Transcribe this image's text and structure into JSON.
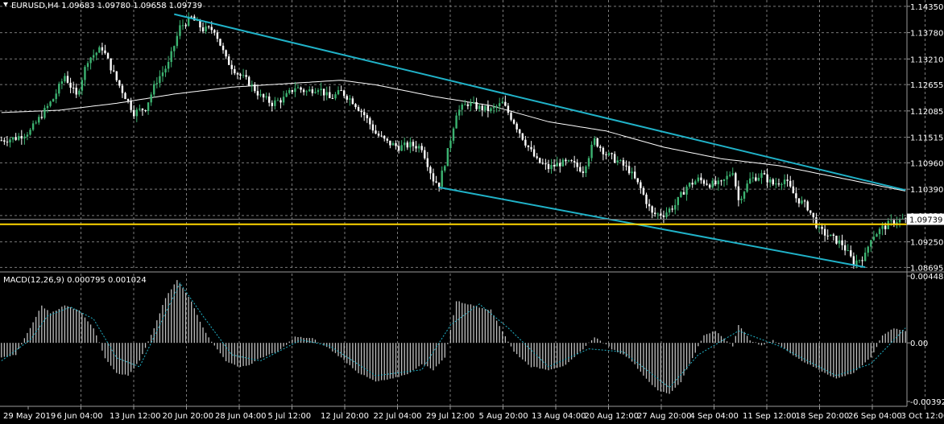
{
  "colors": {
    "background": "#000000",
    "grid": "#7a7a7a",
    "text": "#ffffff",
    "bull_candle": "#3cb371",
    "bear_candle": "#ffffff",
    "moving_average": "#ffffff",
    "channel": "#20b2c8",
    "horizontal_level": "#ffd700",
    "macd_histogram": "#c0c0c0",
    "macd_signal": "#20b2c8",
    "price_tag_bg": "#ffffff",
    "price_tag_text": "#000000"
  },
  "price_panel": {
    "title": "EURUSD,H4  1.09683 1.09780 1.09658 1.09739",
    "current_price_label": "1.09739",
    "y_ticks": [
      "1.14350",
      "1.13780",
      "1.13210",
      "1.12655",
      "1.12085",
      "1.11515",
      "1.10960",
      "1.10390",
      "1.09820",
      "1.09250",
      "1.08695"
    ]
  },
  "macd_panel": {
    "title": "MACD(12,26,9) 0.000795 0.001024",
    "y_ticks": [
      "0.004481",
      "0.00",
      "-0.003925"
    ]
  },
  "x_ticks": [
    "29 May 2019",
    "6 Jun 04:00",
    "13 Jun 12:00",
    "20 Jun 20:00",
    "28 Jun 04:00",
    "5 Jul 12:00",
    "12 Jul 20:00",
    "22 Jul 04:00",
    "29 Jul 12:00",
    "5 Aug 20:00",
    "13 Aug 04:00",
    "20 Aug 12:00",
    "27 Aug 20:00",
    "4 Sep 04:00",
    "11 Sep 12:00",
    "18 Sep 20:00",
    "26 Sep 04:00",
    "3 Oct 12:00"
  ],
  "chart_data": [
    {
      "type": "candlestick",
      "symbol": "EURUSD",
      "timeframe": "H4",
      "ohlc_last": {
        "open": 1.09683,
        "high": 1.0978,
        "low": 1.09658,
        "close": 1.09739
      },
      "ylim": [
        1.0865,
        1.144
      ],
      "close_path": [
        [
          0,
          1.1145
        ],
        [
          5,
          1.115
        ],
        [
          10,
          1.1165
        ],
        [
          18,
          1.1235
        ],
        [
          22,
          1.1285
        ],
        [
          26,
          1.124
        ],
        [
          30,
          1.132
        ],
        [
          35,
          1.1345
        ],
        [
          40,
          1.1275
        ],
        [
          46,
          1.1205
        ],
        [
          50,
          1.1215
        ],
        [
          54,
          1.1275
        ],
        [
          58,
          1.131
        ],
        [
          62,
          1.139
        ],
        [
          66,
          1.141
        ],
        [
          70,
          1.1385
        ],
        [
          74,
          1.1385
        ],
        [
          78,
          1.132
        ],
        [
          82,
          1.129
        ],
        [
          86,
          1.127
        ],
        [
          90,
          1.124
        ],
        [
          94,
          1.1225
        ],
        [
          98,
          1.1235
        ],
        [
          102,
          1.126
        ],
        [
          106,
          1.125
        ],
        [
          110,
          1.126
        ],
        [
          114,
          1.1235
        ],
        [
          118,
          1.125
        ],
        [
          122,
          1.123
        ],
        [
          126,
          1.12
        ],
        [
          130,
          1.116
        ],
        [
          134,
          1.114
        ],
        [
          138,
          1.113
        ],
        [
          142,
          1.1135
        ],
        [
          146,
          1.113
        ],
        [
          150,
          1.106
        ],
        [
          152,
          1.105
        ],
        [
          155,
          1.112
        ],
        [
          158,
          1.1205
        ],
        [
          162,
          1.1225
        ],
        [
          166,
          1.1215
        ],
        [
          170,
          1.121
        ],
        [
          174,
          1.1225
        ],
        [
          178,
          1.1185
        ],
        [
          182,
          1.114
        ],
        [
          186,
          1.11
        ],
        [
          190,
          1.1085
        ],
        [
          194,
          1.1095
        ],
        [
          198,
          1.1095
        ],
        [
          202,
          1.108
        ],
        [
          206,
          1.1145
        ],
        [
          210,
          1.1115
        ],
        [
          214,
          1.11
        ],
        [
          218,
          1.108
        ],
        [
          222,
          1.104
        ],
        [
          226,
          1.0985
        ],
        [
          230,
          1.0985
        ],
        [
          234,
          1.1005
        ],
        [
          238,
          1.1045
        ],
        [
          242,
          1.106
        ],
        [
          246,
          1.105
        ],
        [
          250,
          1.105
        ],
        [
          254,
          1.108
        ],
        [
          256,
          1.1015
        ],
        [
          260,
          1.106
        ],
        [
          264,
          1.107
        ],
        [
          268,
          1.105
        ],
        [
          272,
          1.106
        ],
        [
          276,
          1.102
        ],
        [
          280,
          1.1
        ],
        [
          284,
          1.095
        ],
        [
          288,
          1.0935
        ],
        [
          292,
          1.092
        ],
        [
          296,
          1.088
        ],
        [
          300,
          1.0895
        ],
        [
          302,
          1.0935
        ],
        [
          306,
          1.0955
        ],
        [
          310,
          1.097
        ],
        [
          314,
          1.0974
        ]
      ],
      "moving_average": [
        [
          0,
          1.1205
        ],
        [
          20,
          1.121
        ],
        [
          40,
          1.1225
        ],
        [
          60,
          1.1245
        ],
        [
          80,
          1.126
        ],
        [
          100,
          1.1268
        ],
        [
          118,
          1.1275
        ],
        [
          130,
          1.1265
        ],
        [
          150,
          1.124
        ],
        [
          170,
          1.122
        ],
        [
          190,
          1.1185
        ],
        [
          210,
          1.1165
        ],
        [
          230,
          1.113
        ],
        [
          250,
          1.1105
        ],
        [
          270,
          1.109
        ],
        [
          290,
          1.1065
        ],
        [
          314,
          1.1035
        ]
      ],
      "channel_upper": [
        [
          60,
          1.1418
        ],
        [
          314,
          1.1037
        ]
      ],
      "channel_lower": [
        [
          152,
          1.1043
        ],
        [
          300,
          1.087
        ]
      ],
      "horizontal_level": 1.0963
    },
    {
      "type": "bar",
      "name": "MACD(12,26,9)",
      "ylim": [
        -0.003925,
        0.004481
      ],
      "histogram_path": [
        [
          0,
          -0.001
        ],
        [
          5,
          -0.0008
        ],
        [
          10,
          0.001
        ],
        [
          14,
          0.0025
        ],
        [
          17,
          0.002
        ],
        [
          22,
          0.0025
        ],
        [
          27,
          0.0022
        ],
        [
          32,
          0.001
        ],
        [
          36,
          -0.001
        ],
        [
          40,
          -0.002
        ],
        [
          44,
          -0.0022
        ],
        [
          48,
          -0.0012
        ],
        [
          52,
          0.0005
        ],
        [
          57,
          0.003
        ],
        [
          61,
          0.0042
        ],
        [
          66,
          0.0028
        ],
        [
          70,
          0.001
        ],
        [
          74,
          -0.0002
        ],
        [
          78,
          -0.0012
        ],
        [
          82,
          -0.0016
        ],
        [
          86,
          -0.0015
        ],
        [
          90,
          -0.001
        ],
        [
          96,
          -0.0006
        ],
        [
          102,
          0.0004
        ],
        [
          108,
          0.0003
        ],
        [
          114,
          -0.0004
        ],
        [
          118,
          -0.001
        ],
        [
          124,
          -0.002
        ],
        [
          130,
          -0.0026
        ],
        [
          136,
          -0.0024
        ],
        [
          142,
          -0.002
        ],
        [
          146,
          -0.0014
        ],
        [
          150,
          -0.0018
        ],
        [
          154,
          -0.001
        ],
        [
          158,
          0.0028
        ],
        [
          164,
          0.0025
        ],
        [
          170,
          0.0022
        ],
        [
          174,
          0.0008
        ],
        [
          178,
          -0.0006
        ],
        [
          184,
          -0.0016
        ],
        [
          190,
          -0.0018
        ],
        [
          196,
          -0.0015
        ],
        [
          200,
          -0.0008
        ],
        [
          206,
          0.0004
        ],
        [
          212,
          -0.0004
        ],
        [
          218,
          -0.001
        ],
        [
          224,
          -0.0024
        ],
        [
          228,
          -0.0032
        ],
        [
          232,
          -0.0034
        ],
        [
          236,
          -0.0026
        ],
        [
          240,
          -0.001
        ],
        [
          244,
          0.0005
        ],
        [
          248,
          0.0008
        ],
        [
          254,
          -0.0002
        ],
        [
          256,
          0.0012
        ],
        [
          260,
          0.0002
        ],
        [
          264,
          -0.0002
        ],
        [
          268,
          0.0002
        ],
        [
          272,
          -0.0004
        ],
        [
          278,
          -0.0012
        ],
        [
          284,
          -0.0018
        ],
        [
          290,
          -0.0024
        ],
        [
          296,
          -0.002
        ],
        [
          302,
          -0.001
        ],
        [
          306,
          0.0005
        ],
        [
          310,
          0.001
        ],
        [
          314,
          0.0008
        ]
      ],
      "signal_path": [
        [
          0,
          -0.0012
        ],
        [
          10,
          0.0002
        ],
        [
          16,
          0.0018
        ],
        [
          24,
          0.0024
        ],
        [
          32,
          0.0016
        ],
        [
          40,
          -0.001
        ],
        [
          48,
          -0.0016
        ],
        [
          56,
          0.0016
        ],
        [
          62,
          0.004
        ],
        [
          70,
          0.0018
        ],
        [
          80,
          -0.0008
        ],
        [
          90,
          -0.0012
        ],
        [
          104,
          0.0002
        ],
        [
          114,
          -0.0002
        ],
        [
          130,
          -0.0022
        ],
        [
          146,
          -0.0018
        ],
        [
          156,
          0.0012
        ],
        [
          166,
          0.0026
        ],
        [
          176,
          0.001
        ],
        [
          190,
          -0.0016
        ],
        [
          204,
          -0.0004
        ],
        [
          216,
          -0.0006
        ],
        [
          232,
          -0.003
        ],
        [
          242,
          -0.0008
        ],
        [
          256,
          0.0008
        ],
        [
          270,
          -0.0002
        ],
        [
          290,
          -0.0022
        ],
        [
          302,
          -0.0014
        ],
        [
          314,
          0.001
        ]
      ]
    }
  ]
}
